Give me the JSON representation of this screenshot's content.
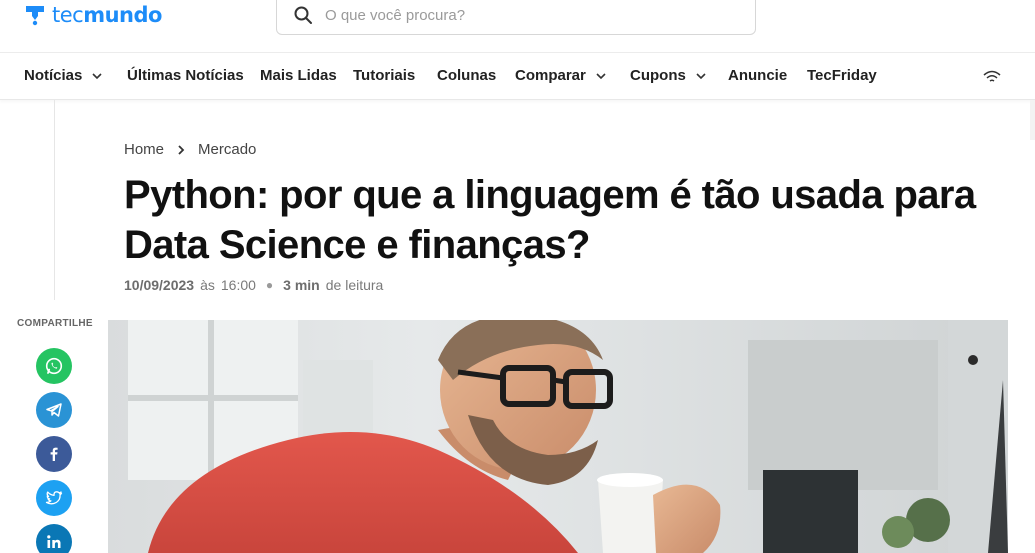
{
  "brand": {
    "logo_text_a": "tec",
    "logo_text_b": "mundo",
    "color": "#1d8cf8"
  },
  "search": {
    "placeholder": "O que você procura?"
  },
  "nav": {
    "items": [
      {
        "label": "Notícias",
        "has_dropdown": true
      },
      {
        "label": "Últimas Notícias",
        "has_dropdown": false
      },
      {
        "label": "Mais Lidas",
        "has_dropdown": false
      },
      {
        "label": "Tutoriais",
        "has_dropdown": false
      },
      {
        "label": "Colunas",
        "has_dropdown": false
      },
      {
        "label": "Comparar",
        "has_dropdown": true
      },
      {
        "label": "Cupons",
        "has_dropdown": true
      },
      {
        "label": "Anuncie",
        "has_dropdown": false
      },
      {
        "label": "TecFriday",
        "has_dropdown": false
      }
    ],
    "right_icon": "wifi-icon"
  },
  "breadcrumb": {
    "items": [
      "Home",
      "Mercado"
    ]
  },
  "article": {
    "title": "Python: por que a linguagem é tão usada para Data Science e finanças?",
    "date": "10/09/2023",
    "time_prefix": "às",
    "time": "16:00",
    "read_time": "3 min",
    "read_suffix": "de leitura"
  },
  "share": {
    "label": "COMPARTILHE",
    "buttons": [
      {
        "name": "whatsapp",
        "icon": "whatsapp-icon",
        "color": "#25c462"
      },
      {
        "name": "telegram",
        "icon": "telegram-icon",
        "color": "#2a93d5"
      },
      {
        "name": "facebook",
        "icon": "facebook-icon",
        "color": "#3c5a99"
      },
      {
        "name": "twitter",
        "icon": "twitter-icon",
        "color": "#1da1f2"
      },
      {
        "name": "linkedin",
        "icon": "linkedin-icon",
        "color": "#0a77b5"
      }
    ]
  },
  "hero": {
    "icon": "article-hero-photo"
  }
}
